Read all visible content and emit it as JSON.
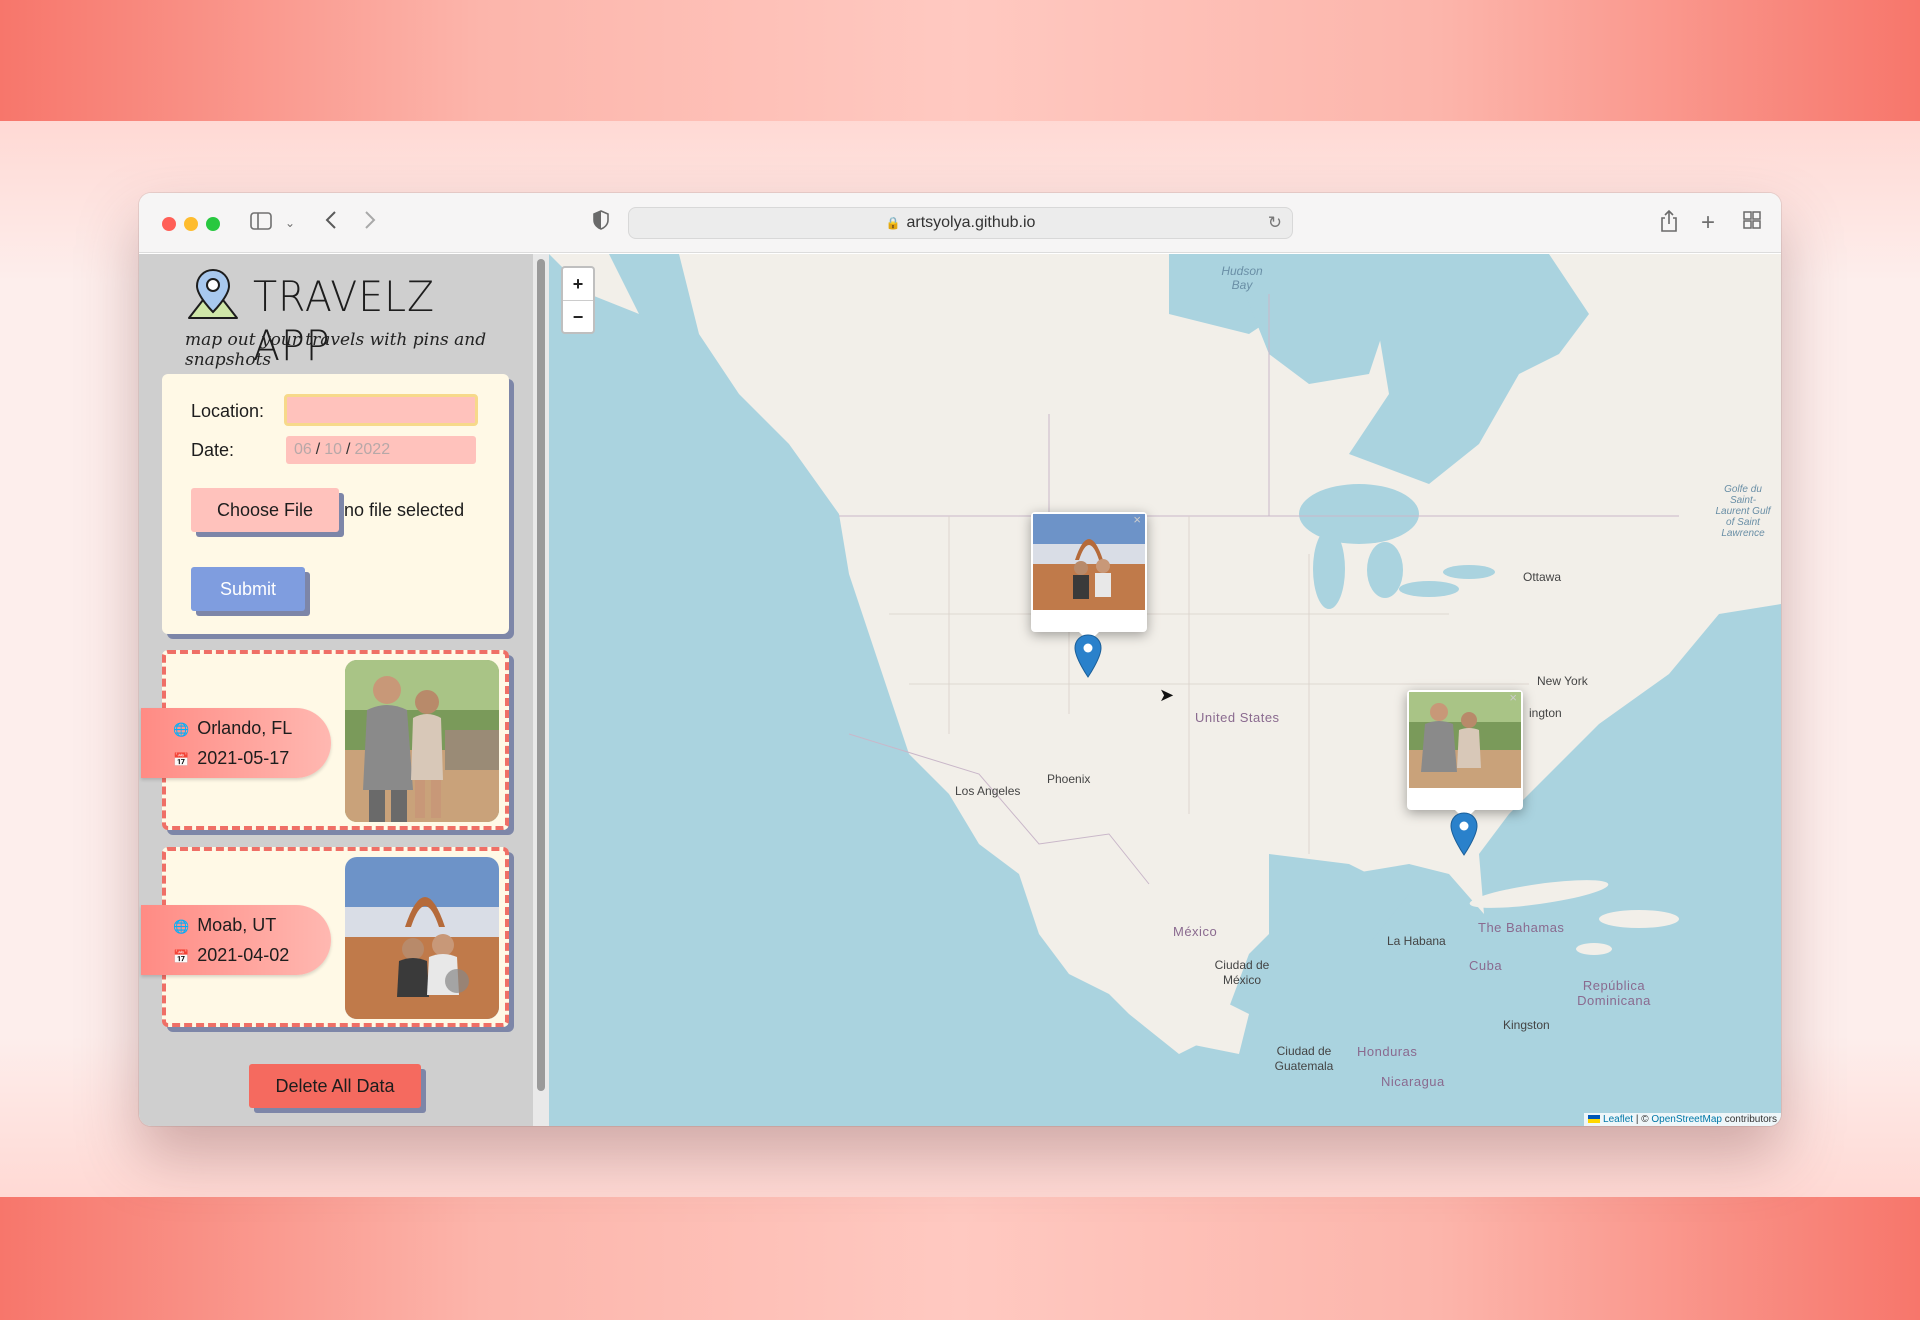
{
  "browser": {
    "url": "artsyolya.github.io"
  },
  "app": {
    "title": "TRAVELZ APP",
    "subtitle": "map out your travels with pins and snapshots"
  },
  "form": {
    "location_label": "Location:",
    "location_value": "",
    "date_label": "Date:",
    "date_month": "06",
    "date_day": "10",
    "date_year": "2022",
    "date_sep": "/",
    "choose_file_label": "Choose File",
    "file_status": "no file selected",
    "submit_label": "Submit"
  },
  "entries": [
    {
      "location": "Orlando, FL",
      "date": "2021-05-17",
      "photo": "couple-at-zoo-photo"
    },
    {
      "location": "Moab, UT",
      "date": "2021-04-02",
      "photo": "couple-at-delicate-arch-photo"
    }
  ],
  "delete_label": "Delete All Data",
  "map": {
    "zoom_in": "+",
    "zoom_out": "−",
    "labels": {
      "hudson_bay": "Hudson Bay",
      "golfe": "Golfe du Saint-Laurent Gulf of Saint Lawrence",
      "ottawa": "Ottawa",
      "new_york": "New York",
      "washington": "ington",
      "united_states": "United States",
      "los_angeles": "Los Angeles",
      "phoenix": "Phoenix",
      "mexico": "México",
      "ciudad_mexico": "Ciudad de México",
      "la_habana": "La Habana",
      "bahamas": "The Bahamas",
      "cuba": "Cuba",
      "republica": "República Dominicana",
      "kingston": "Kingston",
      "guatemala": "Ciudad de Guatemala",
      "honduras": "Honduras",
      "nicaragua": "Nicaragua"
    },
    "attribution_leaflet": "Leaflet",
    "attribution_mid": " | © ",
    "attribution_osm": "OpenStreetMap",
    "attribution_end": " contributors",
    "popup_close": "×"
  },
  "colors": {
    "accent_coral": "#f56a5f",
    "card_cream": "#fff9e6",
    "submit_blue": "#7f9ddf",
    "marker_blue": "#2a81cb"
  }
}
